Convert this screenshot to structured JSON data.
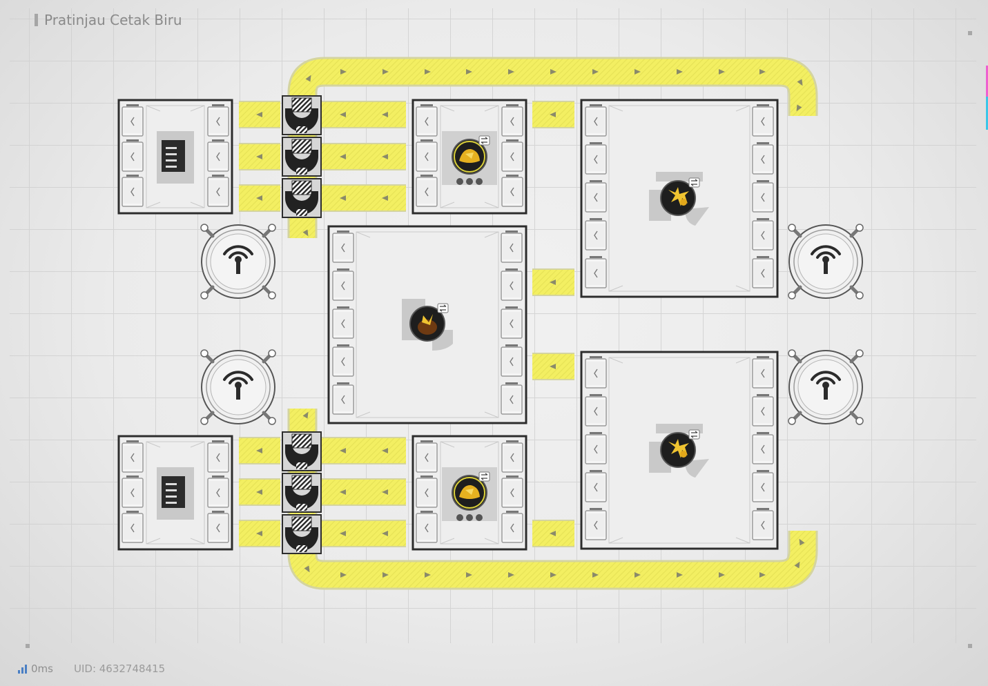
{
  "header": {
    "title": "Pratinjau Cetak Biru"
  },
  "footer": {
    "ping": "0ms",
    "uid": "UID: 4632748415"
  },
  "colors": {
    "belt": "#f3ef62",
    "belt_edge": "#d8d68a",
    "machine_frame": "#2d2d2d",
    "signal": "#4a7fc4",
    "ore": "#e6b120",
    "edge_accent_pink": "#ee5fd0",
    "edge_accent_cyan": "#39c6e8"
  },
  "machines": [
    {
      "name": "depot-unloader-top",
      "icon": "storage-document-icon"
    },
    {
      "name": "depot-unloader-bottom",
      "icon": "storage-document-icon"
    },
    {
      "name": "refining-unit-top",
      "icon": "gold-ore-icon"
    },
    {
      "name": "refining-unit-bottom",
      "icon": "gold-ore-icon"
    },
    {
      "name": "shredding-unit-center",
      "icon": "amber-powder-icon"
    },
    {
      "name": "grinding-unit-top",
      "icon": "yellow-crystal-icon"
    },
    {
      "name": "grinding-unit-bottom",
      "icon": "yellow-crystal-icon"
    }
  ],
  "relays": [
    {
      "name": "relay-tower-left-top",
      "icon": "antenna-icon"
    },
    {
      "name": "relay-tower-left-bottom",
      "icon": "antenna-icon"
    },
    {
      "name": "relay-tower-right-top",
      "icon": "antenna-icon"
    },
    {
      "name": "relay-tower-right-bottom",
      "icon": "antenna-icon"
    }
  ]
}
